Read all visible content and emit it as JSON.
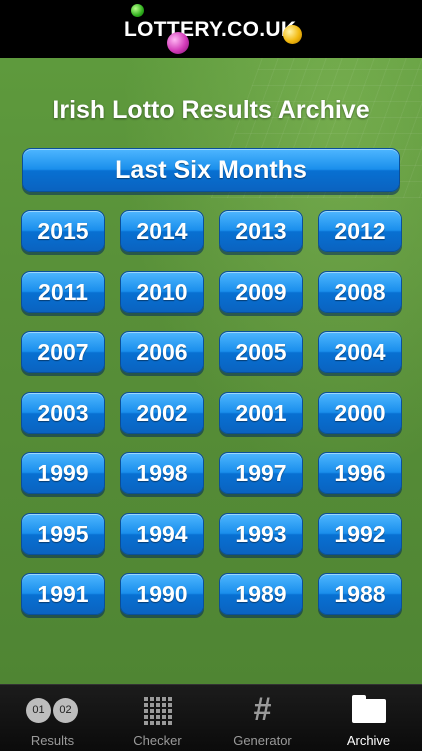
{
  "header": {
    "logo_text": "LOTTERY.CO.UK"
  },
  "main": {
    "title": "Irish Lotto Results Archive",
    "last_six_months_label": "Last Six Months",
    "years": [
      "2015",
      "2014",
      "2013",
      "2012",
      "2011",
      "2010",
      "2009",
      "2008",
      "2007",
      "2006",
      "2005",
      "2004",
      "2003",
      "2002",
      "2001",
      "2000",
      "1999",
      "1998",
      "1997",
      "1996",
      "1995",
      "1994",
      "1993",
      "1992",
      "1991",
      "1990",
      "1989",
      "1988"
    ]
  },
  "tabbar": {
    "tabs": [
      {
        "label": "Results",
        "icon": "number-balls-icon",
        "balls": [
          "01",
          "02"
        ]
      },
      {
        "label": "Checker",
        "icon": "grid-icon"
      },
      {
        "label": "Generator",
        "icon": "hash-icon",
        "glyph": "#"
      },
      {
        "label": "Archive",
        "icon": "folder-icon",
        "active": true
      }
    ]
  },
  "colors": {
    "button_blue": "#1a8fec",
    "background_green": "#588f38",
    "tabbar_bg": "#111111",
    "tab_inactive": "#9a9a9a",
    "tab_active": "#ffffff"
  }
}
